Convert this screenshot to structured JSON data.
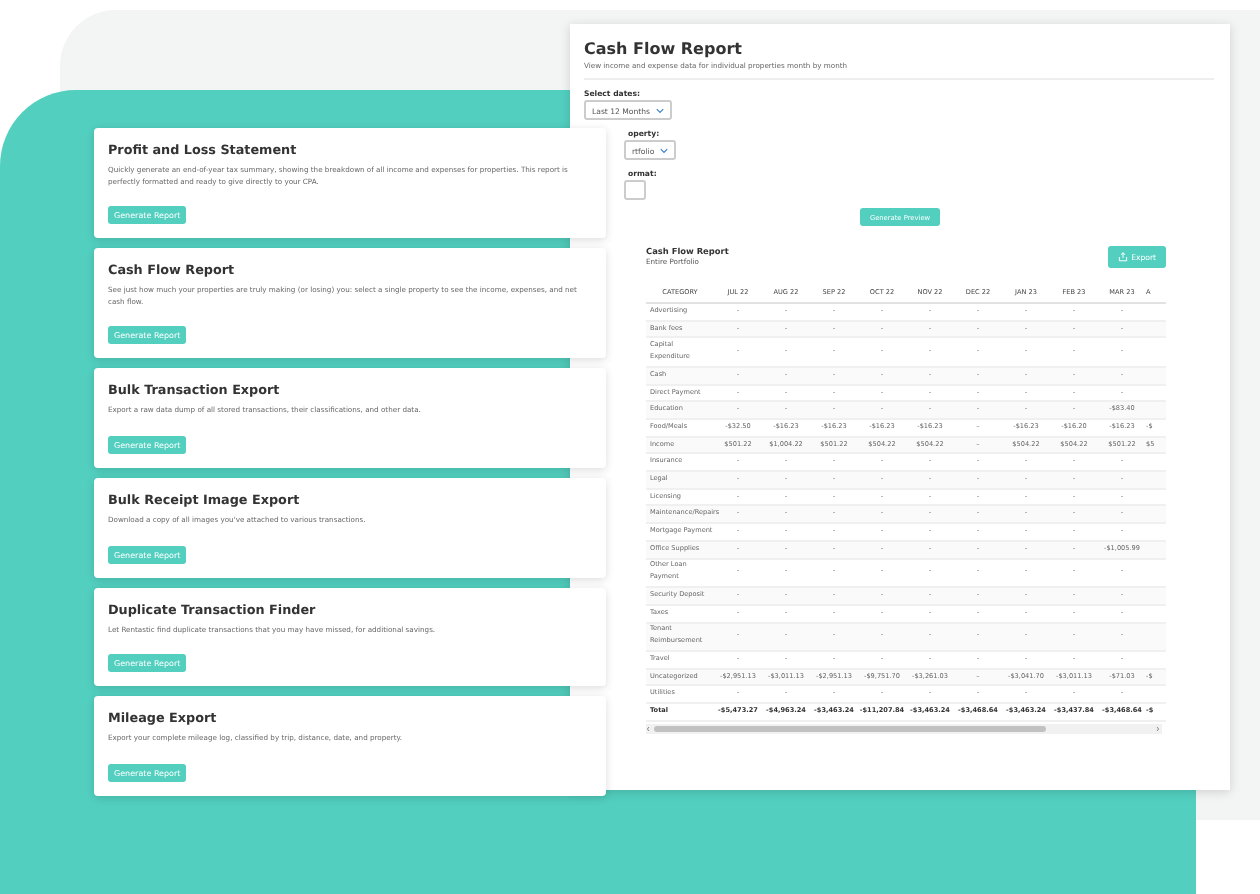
{
  "report_cards": [
    {
      "title": "Profit and Loss Statement",
      "description": "Quickly generate an end-of-year tax summary, showing the breakdown of all income and expenses for properties. This report is perfectly formatted and ready to give directly to your CPA.",
      "button": "Generate Report"
    },
    {
      "title": "Cash Flow Report",
      "description": "See just how much your properties are truly making (or losing) you: select a single property to see the income, expenses, and net cash flow.",
      "button": "Generate Report"
    },
    {
      "title": "Bulk Transaction Export",
      "description": "Export a raw data dump of all stored transactions, their classifications, and other data.",
      "button": "Generate Report"
    },
    {
      "title": "Bulk Receipt Image Export",
      "description": "Download a copy of all images you've attached to various transactions.",
      "button": "Generate Report"
    },
    {
      "title": "Duplicate Transaction Finder",
      "description": "Let Rentastic find duplicate transactions that you may have missed, for additional savings.",
      "button": "Generate Report"
    },
    {
      "title": "Mileage Export",
      "description": "Export your complete mileage log, classified by trip, distance, date, and property.",
      "button": "Generate Report"
    }
  ],
  "preview": {
    "title": "Cash Flow Report",
    "subtitle": "View income and expense data for individual properties month by month",
    "fields": [
      {
        "label": "Select dates:",
        "value": "Last 12 Months",
        "partly_hidden": false
      },
      {
        "label": "operty:",
        "value": "rtfolio",
        "partly_hidden": true
      },
      {
        "label": "ormat:",
        "partly_hidden": true
      }
    ],
    "button": "Generate Preview"
  },
  "table_panel": {
    "title": "Cash Flow Report",
    "subtitle": "Entire Portfolio",
    "export_button": "Export",
    "columns": [
      "CATEGORY",
      "JUL 22",
      "AUG 22",
      "SEP 22",
      "OCT 22",
      "NOV 22",
      "DEC 22",
      "JAN 23",
      "FEB 23",
      "MAR 23",
      "A"
    ],
    "rows": [
      {
        "category": "Advertising",
        "values": [
          "-",
          "-",
          "-",
          "-",
          "-",
          "-",
          "-",
          "-",
          "-"
        ]
      },
      {
        "category": "Bank fees",
        "values": [
          "-",
          "-",
          "-",
          "-",
          "-",
          "-",
          "-",
          "-",
          "-"
        ]
      },
      {
        "category": "Capital Expenditure",
        "values": [
          "-",
          "-",
          "-",
          "-",
          "-",
          "-",
          "-",
          "-",
          "-"
        ]
      },
      {
        "category": "Cash",
        "values": [
          "-",
          "-",
          "-",
          "-",
          "-",
          "-",
          "-",
          "-",
          "-"
        ]
      },
      {
        "category": "Direct Payment",
        "values": [
          "-",
          "-",
          "-",
          "-",
          "-",
          "-",
          "-",
          "-",
          "-"
        ]
      },
      {
        "category": "Education",
        "values": [
          "-",
          "-",
          "-",
          "-",
          "-",
          "-",
          "-",
          "-",
          "-$83.40"
        ]
      },
      {
        "category": "Food/Meals",
        "values": [
          "-$32.50",
          "-$16.23",
          "-$16.23",
          "-$16.23",
          "-$16.23",
          "–",
          "-$16.23",
          "-$16.20",
          "-$16.23"
        ],
        "edge_value": "-$"
      },
      {
        "category": "Income",
        "values": [
          "$501.22",
          "$1,004.22",
          "$501.22",
          "$504.22",
          "$504.22",
          "–",
          "$504.22",
          "$504.22",
          "$501.22"
        ],
        "edge_value": "$5"
      },
      {
        "category": "Insurance",
        "values": [
          "-",
          "-",
          "-",
          "-",
          "-",
          "-",
          "-",
          "-",
          "-"
        ]
      },
      {
        "category": "Legal",
        "values": [
          "-",
          "-",
          "-",
          "-",
          "-",
          "-",
          "-",
          "-",
          "-"
        ]
      },
      {
        "category": "Licensing",
        "values": [
          "-",
          "-",
          "-",
          "-",
          "-",
          "-",
          "-",
          "-",
          "-"
        ]
      },
      {
        "category": "Maintenance/Repairs",
        "values": [
          "-",
          "-",
          "-",
          "-",
          "-",
          "-",
          "-",
          "-",
          "-"
        ]
      },
      {
        "category": "Mortgage Payment",
        "values": [
          "-",
          "-",
          "-",
          "-",
          "-",
          "-",
          "-",
          "-",
          "-"
        ]
      },
      {
        "category": "Office Supplies",
        "values": [
          "-",
          "-",
          "-",
          "-",
          "-",
          "-",
          "-",
          "-",
          "-$1,005.99"
        ]
      },
      {
        "category": "Other Loan Payment",
        "values": [
          "-",
          "-",
          "-",
          "-",
          "-",
          "-",
          "-",
          "-",
          "-"
        ]
      },
      {
        "category": "Security Deposit",
        "values": [
          "-",
          "-",
          "-",
          "-",
          "-",
          "-",
          "-",
          "-",
          "-"
        ]
      },
      {
        "category": "Taxes",
        "values": [
          "-",
          "-",
          "-",
          "-",
          "-",
          "-",
          "-",
          "-",
          "-"
        ]
      },
      {
        "category": "Tenant Reimbursement",
        "values": [
          "-",
          "-",
          "-",
          "-",
          "-",
          "-",
          "-",
          "-",
          "-"
        ]
      },
      {
        "category": "Travel",
        "values": [
          "-",
          "-",
          "-",
          "-",
          "-",
          "-",
          "-",
          "-",
          "-"
        ]
      },
      {
        "category": "Uncategorized",
        "values": [
          "-$2,951.13",
          "-$3,011.13",
          "-$2,951.13",
          "-$9,751.70",
          "-$3,261.03",
          "–",
          "-$3,041.70",
          "-$3,011.13",
          "-$71.03"
        ],
        "edge_value": "-$"
      },
      {
        "category": "Utilities",
        "values": [
          "-",
          "-",
          "-",
          "-",
          "-",
          "-",
          "-",
          "-",
          "-"
        ]
      }
    ],
    "total": {
      "category": "Total",
      "values": [
        "-$5,473.27",
        "-$4,963.24",
        "-$3,463.24",
        "-$11,207.84",
        "-$3,463.24",
        "-$3,468.64",
        "-$3,463.24",
        "-$3,437.84",
        "-$3,468.64"
      ],
      "edge_value": "-$"
    }
  }
}
